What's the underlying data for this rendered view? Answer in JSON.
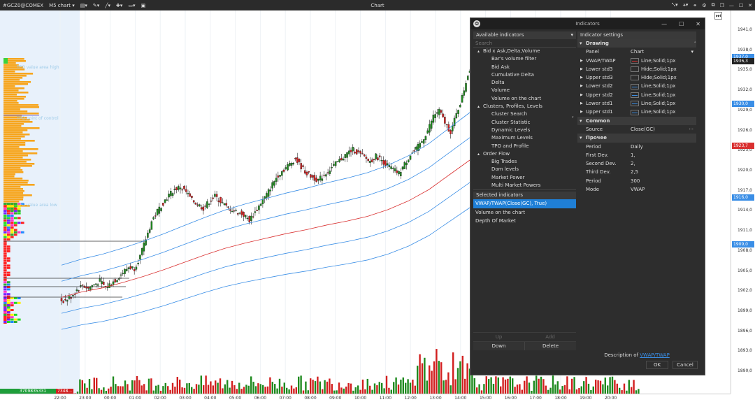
{
  "topbar": {
    "symbol": "#GCZ0@COMEX",
    "timeframe": "M5 chart",
    "title": "Chart"
  },
  "price_axis": {
    "labels": [
      "1941,0",
      "1938,0",
      "1935,0",
      "1932,0",
      "1929,0",
      "1926,0",
      "1923,0",
      "1920,0",
      "1917,0",
      "1914,0",
      "1911,0",
      "1908,0",
      "1905,0",
      "1902,0",
      "1899,0",
      "1896,0",
      "1893,0",
      "1890,0"
    ],
    "tags": [
      {
        "text": "1937,0",
        "color": "#3a8ee6"
      },
      {
        "text": "1936,3",
        "color": "#222222"
      },
      {
        "text": "1930,0",
        "color": "#3a8ee6"
      },
      {
        "text": "1923,7",
        "color": "#d93030"
      },
      {
        "text": "1916,0",
        "color": "#3a8ee6"
      },
      {
        "text": "1909,0",
        "color": "#3a8ee6"
      }
    ]
  },
  "time_axis": {
    "labels": [
      "22:00",
      "23:00",
      "00:00",
      "01:00",
      "02:00",
      "03:00",
      "04:00",
      "05:00",
      "06:00",
      "07:00",
      "08:00",
      "09:00",
      "10:00",
      "11:00",
      "12:00",
      "13:00",
      "14:00",
      "15:00",
      "16:00",
      "17:00",
      "18:00",
      "19:00",
      "20:00"
    ]
  },
  "profile_labels": {
    "vah": "TPO value area high",
    "poc": "TPO point of control",
    "val": "TPO value area low"
  },
  "volume_counts": {
    "left": "3709835331",
    "right": "7348..."
  },
  "dialog": {
    "title": "Indicators",
    "available_header": "Available indicators",
    "search_placeholder": "Search",
    "tree": [
      {
        "label": "Bid x Ask,Delta,Volume",
        "group": true
      },
      {
        "label": "Bar's volume filter",
        "group": false
      },
      {
        "label": "Bid Ask",
        "group": false
      },
      {
        "label": "Cumulative Delta",
        "group": false
      },
      {
        "label": "Delta",
        "group": false
      },
      {
        "label": "Volume",
        "group": false
      },
      {
        "label": "Volume on the chart",
        "group": false
      },
      {
        "label": "Clusters, Profiles, Levels",
        "group": true
      },
      {
        "label": "Cluster Search",
        "group": false
      },
      {
        "label": "Cluster Statistic",
        "group": false
      },
      {
        "label": "Dynamic Levels",
        "group": false
      },
      {
        "label": "Maximum Levels",
        "group": false
      },
      {
        "label": "TPO and Profile",
        "group": false
      },
      {
        "label": "Order Flow",
        "group": true
      },
      {
        "label": "Big Trades",
        "group": false
      },
      {
        "label": "Dom levels",
        "group": false
      },
      {
        "label": "Market Power",
        "group": false
      },
      {
        "label": "Multi Market Powers",
        "group": false
      }
    ],
    "selected_header": "Selected indicators",
    "selected": [
      {
        "label": "VWAP/TWAP(Close(GC), True)",
        "active": true
      },
      {
        "label": "Volume on the chart",
        "active": false
      },
      {
        "label": "Depth Of Market",
        "active": false
      }
    ],
    "buttons": {
      "up": "Up",
      "add": "Add",
      "down": "Down",
      "delete": "Delete",
      "ok": "OK",
      "cancel": "Cancel"
    },
    "settings_header": "Indicator settings",
    "drawing_section": "Drawing",
    "panel": {
      "key": "Panel",
      "value": "Chart"
    },
    "drawing_rows": [
      {
        "key": "VWAP/TWAP",
        "value": "Line;Solid;1px",
        "color": "#d93030"
      },
      {
        "key": "Lower std3",
        "value": "Hide;Solid;1px",
        "color": "#2d2d2d"
      },
      {
        "key": "Upper std3",
        "value": "Hide;Solid;1px",
        "color": "#2d2d2d"
      },
      {
        "key": "Lower std2",
        "value": "Line;Solid;1px",
        "color": "#3a8ee6"
      },
      {
        "key": "Upper std2",
        "value": "Line;Solid;1px",
        "color": "#3a8ee6"
      },
      {
        "key": "Lower std1",
        "value": "Line;Solid;1px",
        "color": "#3a8ee6"
      },
      {
        "key": "Upper std1",
        "value": "Line;Solid;1px",
        "color": "#3a8ee6"
      }
    ],
    "common_section": "Common",
    "source": {
      "key": "Source",
      "value": "Close(GC)"
    },
    "other_section": "Прочее",
    "other_rows": [
      {
        "key": "Period",
        "value": "Daily"
      },
      {
        "key": "First Dev.",
        "value": "1,"
      },
      {
        "key": "Second Dev.",
        "value": "2,"
      },
      {
        "key": "Third Dev.",
        "value": "2,5"
      },
      {
        "key": "Period",
        "value": "300"
      },
      {
        "key": "Mode",
        "value": "VWAP"
      }
    ],
    "description_prefix": "Description of",
    "description_link": "VWAP/TWAP"
  },
  "colors": {
    "up": "#1f8a1f",
    "down": "#d21f1f",
    "band": "#3a8ee6",
    "vwap": "#d93030",
    "profile": "#f7a51c",
    "session_bg": "#e8f1fb"
  },
  "chart_data": {
    "type": "candlestick",
    "vwap": [
      [
        1899.5,
        0
      ],
      [
        1900.3,
        0.04
      ],
      [
        1900.9,
        0.08
      ],
      [
        1901.7,
        0.12
      ],
      [
        1902.6,
        0.16
      ],
      [
        1903.6,
        0.2
      ],
      [
        1904.7,
        0.24
      ],
      [
        1905.8,
        0.28
      ],
      [
        1906.8,
        0.32
      ],
      [
        1907.6,
        0.36
      ],
      [
        1908.3,
        0.4
      ],
      [
        1909.0,
        0.44
      ],
      [
        1909.6,
        0.48
      ],
      [
        1910.3,
        0.52
      ],
      [
        1910.9,
        0.56
      ],
      [
        1911.6,
        0.6
      ],
      [
        1912.6,
        0.64
      ],
      [
        1913.9,
        0.68
      ],
      [
        1915.6,
        0.72
      ],
      [
        1917.8,
        0.76
      ],
      [
        1920.0,
        0.8
      ]
    ],
    "price_path": [
      1899.0,
      1899.6,
      1900.6,
      1901.3,
      1900.8,
      1901.4,
      1901.9,
      1901.0,
      1901.6,
      1902.3,
      1903.2,
      1904.0,
      1903.8,
      1905.6,
      1908.2,
      1910.8,
      1912.4,
      1913.6,
      1914.8,
      1915.6,
      1916.0,
      1915.2,
      1914.0,
      1913.4,
      1912.8,
      1913.8,
      1914.6,
      1913.8,
      1913.0,
      1912.6,
      1912.2,
      1911.8,
      1911.0,
      1912.2,
      1913.6,
      1914.8,
      1916.4,
      1917.8,
      1918.6,
      1919.4,
      1920.2,
      1919.0,
      1918.0,
      1917.4,
      1917.0,
      1917.8,
      1918.6,
      1919.4,
      1920.2,
      1921.0,
      1921.6,
      1921.0,
      1920.4,
      1919.8,
      1920.6,
      1920.0,
      1919.2,
      1918.6,
      1918.0,
      1919.4,
      1920.8,
      1921.6,
      1922.8,
      1924.4,
      1926.6,
      1927.4,
      1925.6,
      1924.2,
      1926.8,
      1929.4,
      1932.8,
      1934.4
    ]
  }
}
